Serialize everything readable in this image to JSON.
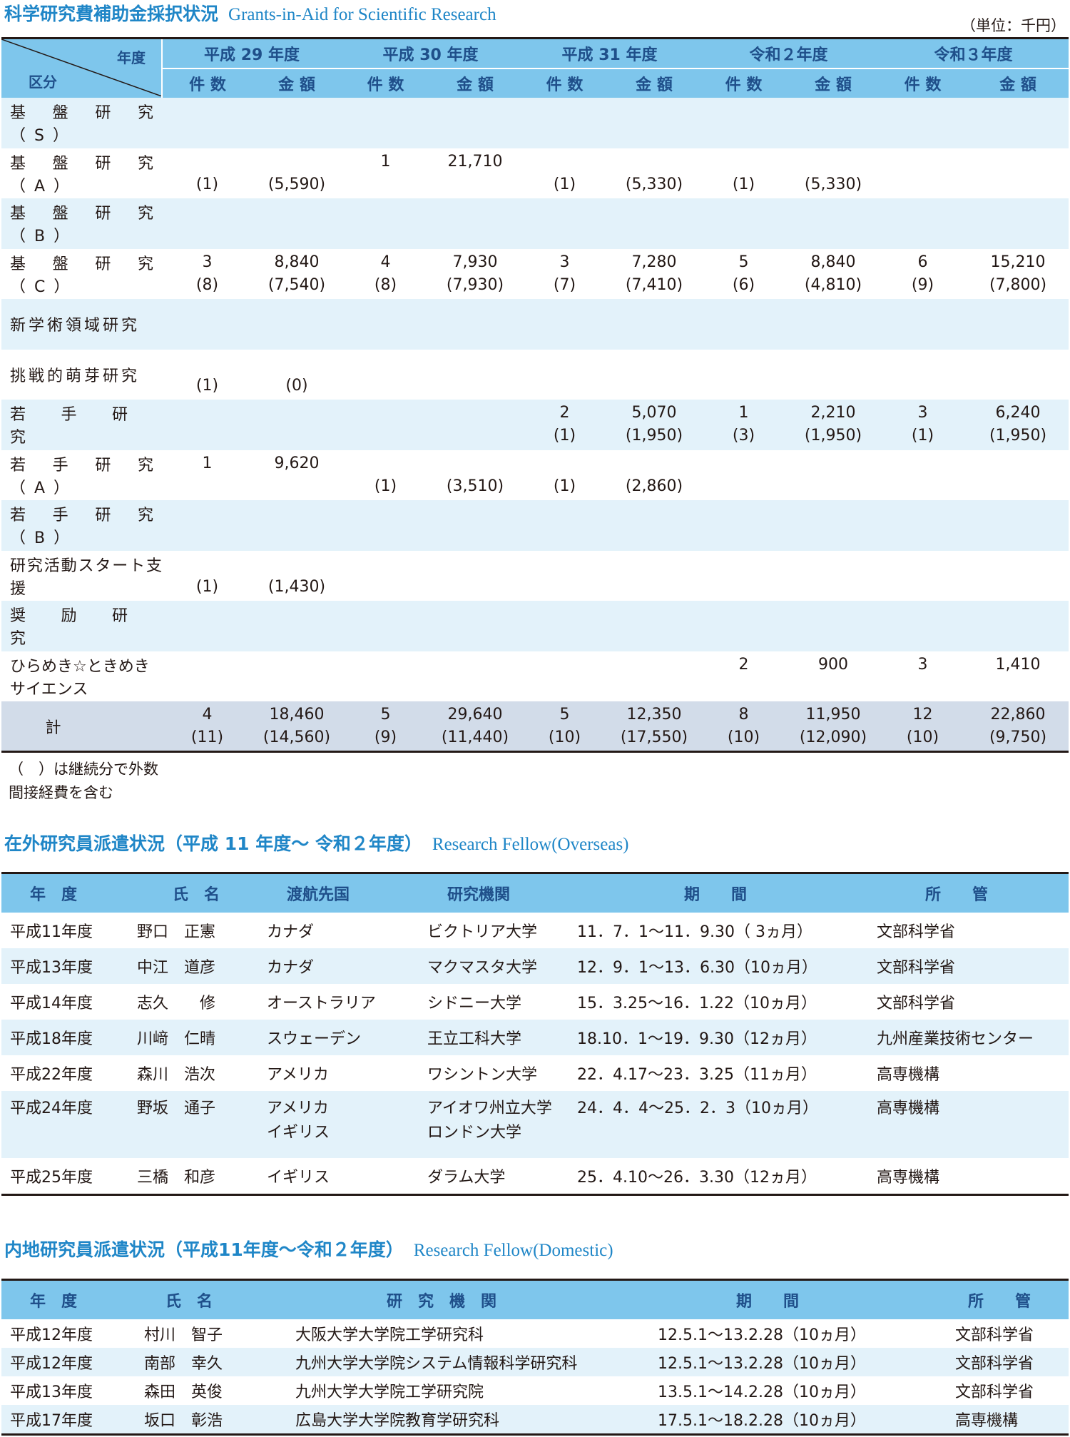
{
  "grants": {
    "title": "科学研究費補助金採択状況",
    "title_en": "Grants-in-Aid for Scientific Research",
    "unit": "（単位：千円）",
    "corner_year": "年度",
    "corner_category": "区分",
    "years": [
      "平成 29 年度",
      "平成 30 年度",
      "平成 31 年度",
      "令和２年度",
      "令和３年度"
    ],
    "count_label": "件 数",
    "amount_label": "金 額",
    "rows": [
      {
        "label": "基盤研究（S）",
        "cells": [
          [
            "",
            ""
          ],
          [
            "",
            ""
          ],
          [
            "",
            ""
          ],
          [
            "",
            ""
          ],
          [
            "",
            ""
          ],
          [
            "",
            ""
          ],
          [
            "",
            ""
          ],
          [
            "",
            ""
          ],
          [
            "",
            ""
          ],
          [
            "",
            ""
          ]
        ]
      },
      {
        "label": "基盤研究（A）",
        "cells": [
          [
            "",
            "(1)"
          ],
          [
            "",
            "(5,590)"
          ],
          [
            "1",
            ""
          ],
          [
            "21,710",
            ""
          ],
          [
            "",
            "(1)"
          ],
          [
            "",
            "(5,330)"
          ],
          [
            "",
            "(1)"
          ],
          [
            "",
            "(5,330)"
          ],
          [
            "",
            ""
          ],
          [
            "",
            ""
          ]
        ]
      },
      {
        "label": "基盤研究（B）",
        "cells": [
          [
            "",
            ""
          ],
          [
            "",
            ""
          ],
          [
            "",
            ""
          ],
          [
            "",
            ""
          ],
          [
            "",
            ""
          ],
          [
            "",
            ""
          ],
          [
            "",
            ""
          ],
          [
            "",
            ""
          ],
          [
            "",
            ""
          ],
          [
            "",
            ""
          ]
        ]
      },
      {
        "label": "基盤研究（C）",
        "cells": [
          [
            "3",
            "(8)"
          ],
          [
            "8,840",
            "(7,540)"
          ],
          [
            "4",
            "(8)"
          ],
          [
            "7,930",
            "(7,930)"
          ],
          [
            "3",
            "(7)"
          ],
          [
            "7,280",
            "(7,410)"
          ],
          [
            "5",
            "(6)"
          ],
          [
            "8,840",
            "(4,810)"
          ],
          [
            "6",
            "(9)"
          ],
          [
            "15,210",
            "(7,800)"
          ]
        ]
      },
      {
        "label": "新学術領域研究",
        "cells": [
          [
            "",
            ""
          ],
          [
            "",
            ""
          ],
          [
            "",
            ""
          ],
          [
            "",
            ""
          ],
          [
            "",
            ""
          ],
          [
            "",
            ""
          ],
          [
            "",
            ""
          ],
          [
            "",
            ""
          ],
          [
            "",
            ""
          ],
          [
            "",
            ""
          ]
        ]
      },
      {
        "label": "挑戦的萌芽研究",
        "cells": [
          [
            "",
            "(1)"
          ],
          [
            "",
            "(0)"
          ],
          [
            "",
            ""
          ],
          [
            "",
            ""
          ],
          [
            "",
            ""
          ],
          [
            "",
            ""
          ],
          [
            "",
            ""
          ],
          [
            "",
            ""
          ],
          [
            "",
            ""
          ],
          [
            "",
            ""
          ]
        ]
      },
      {
        "label": "若手研究",
        "cells": [
          [
            "",
            ""
          ],
          [
            "",
            ""
          ],
          [
            "",
            ""
          ],
          [
            "",
            ""
          ],
          [
            "2",
            "(1)"
          ],
          [
            "5,070",
            "(1,950)"
          ],
          [
            "1",
            "(3)"
          ],
          [
            "2,210",
            "(1,950)"
          ],
          [
            "3",
            "(1)"
          ],
          [
            "6,240",
            "(1,950)"
          ]
        ]
      },
      {
        "label": "若手研究（A）",
        "cells": [
          [
            "1",
            ""
          ],
          [
            "9,620",
            ""
          ],
          [
            "",
            "(1)"
          ],
          [
            "",
            "(3,510)"
          ],
          [
            "",
            "(1)"
          ],
          [
            "",
            "(2,860)"
          ],
          [
            "",
            ""
          ],
          [
            "",
            ""
          ],
          [
            "",
            ""
          ],
          [
            "",
            ""
          ]
        ]
      },
      {
        "label": "若手研究（B）",
        "cells": [
          [
            "",
            ""
          ],
          [
            "",
            ""
          ],
          [
            "",
            ""
          ],
          [
            "",
            ""
          ],
          [
            "",
            ""
          ],
          [
            "",
            ""
          ],
          [
            "",
            ""
          ],
          [
            "",
            ""
          ],
          [
            "",
            ""
          ],
          [
            "",
            ""
          ]
        ]
      },
      {
        "label": "研究活動スタート支援",
        "cells": [
          [
            "",
            "(1)"
          ],
          [
            "",
            "(1,430)"
          ],
          [
            "",
            ""
          ],
          [
            "",
            ""
          ],
          [
            "",
            ""
          ],
          [
            "",
            ""
          ],
          [
            "",
            ""
          ],
          [
            "",
            ""
          ],
          [
            "",
            ""
          ],
          [
            "",
            ""
          ]
        ]
      },
      {
        "label": "奨励研究",
        "cells": [
          [
            "",
            ""
          ],
          [
            "",
            ""
          ],
          [
            "",
            ""
          ],
          [
            "",
            ""
          ],
          [
            "",
            ""
          ],
          [
            "",
            ""
          ],
          [
            "",
            ""
          ],
          [
            "",
            ""
          ],
          [
            "",
            ""
          ],
          [
            "",
            ""
          ]
        ]
      },
      {
        "label": "ひらめき☆ときめき",
        "label2": "サイエンス",
        "cells": [
          [
            "",
            ""
          ],
          [
            "",
            ""
          ],
          [
            "",
            ""
          ],
          [
            "",
            ""
          ],
          [
            "",
            ""
          ],
          [
            "",
            ""
          ],
          [
            "2",
            ""
          ],
          [
            "900",
            ""
          ],
          [
            "3",
            ""
          ],
          [
            "1,410",
            ""
          ]
        ]
      }
    ],
    "total": {
      "label": "計",
      "cells": [
        [
          "4",
          "(11)"
        ],
        [
          "18,460",
          "(14,560)"
        ],
        [
          "5",
          "(9)"
        ],
        [
          "29,640",
          "(11,440)"
        ],
        [
          "5",
          "(10)"
        ],
        [
          "12,350",
          "(17,550)"
        ],
        [
          "8",
          "(10)"
        ],
        [
          "11,950",
          "(12,090)"
        ],
        [
          "12",
          "(10)"
        ],
        [
          "22,860",
          "(9,750)"
        ]
      ]
    },
    "notes": [
      "（　）は継続分で外数",
      "間接経費を含む"
    ]
  },
  "overseas": {
    "title": "在外研究員派遣状況（平成 11 年度～ 令和２年度）",
    "title_en": "Research Fellow(Overseas)",
    "headers": [
      "年　度",
      "氏　名",
      "渡航先国",
      "研究機関",
      "期　　間",
      "所　　管"
    ],
    "rows": [
      [
        "平成11年度",
        "野口　正憲",
        "カナダ",
        "ビクトリア大学",
        "11．7．1～11．9.30（ 3ヵ月）",
        "文部科学省"
      ],
      [
        "平成13年度",
        "中江　道彦",
        "カナダ",
        "マクマスタ大学",
        "12．9．1～13．6.30（10ヵ月）",
        "文部科学省"
      ],
      [
        "平成14年度",
        "志久　　修",
        "オーストラリア",
        "シドニー大学",
        "15．3.25～16．1.22（10ヵ月）",
        "文部科学省"
      ],
      [
        "平成18年度",
        "川﨑　仁晴",
        "スウェーデン",
        "王立工科大学",
        "18.10．1～19．9.30（12ヵ月）",
        "九州産業技術センター"
      ],
      [
        "平成22年度",
        "森川　浩次",
        "アメリカ",
        "ワシントン大学",
        "22．4.17～23．3.25（11ヵ月）",
        "高専機構"
      ],
      [
        "平成24年度",
        "野坂　通子",
        "アメリカ\nイギリス",
        "アイオワ州立大学\nロンドン大学",
        "24．4．4～25．2．3（10ヵ月）",
        "高専機構"
      ],
      [
        "平成25年度",
        "三橋　和彦",
        "イギリス",
        "ダラム大学",
        "25．4.10～26．3.30（12ヵ月）",
        "高専機構"
      ]
    ]
  },
  "domestic": {
    "title": "内地研究員派遣状況（平成11年度～令和２年度）",
    "title_en": "Research Fellow(Domestic)",
    "headers": [
      "年　度",
      "氏　名",
      "研　究　機　関",
      "期　　間",
      "所　　管"
    ],
    "rows": [
      [
        "平成12年度",
        "村川　智子",
        "大阪大学大学院工学研究科",
        "12.5.1～13.2.28（10ヵ月）",
        "文部科学省"
      ],
      [
        "平成12年度",
        "南部　幸久",
        "九州大学大学院システム情報科学研究科",
        "12.5.1～13.2.28（10ヵ月）",
        "文部科学省"
      ],
      [
        "平成13年度",
        "森田　英俊",
        "九州大学大学院工学研究院",
        "13.5.1～14.2.28（10ヵ月）",
        "文部科学省"
      ],
      [
        "平成17年度",
        "坂口　彰浩",
        "広島大学大学院教育学研究科",
        "17.5.1～18.2.28（10ヵ月）",
        "高専機構"
      ]
    ]
  }
}
